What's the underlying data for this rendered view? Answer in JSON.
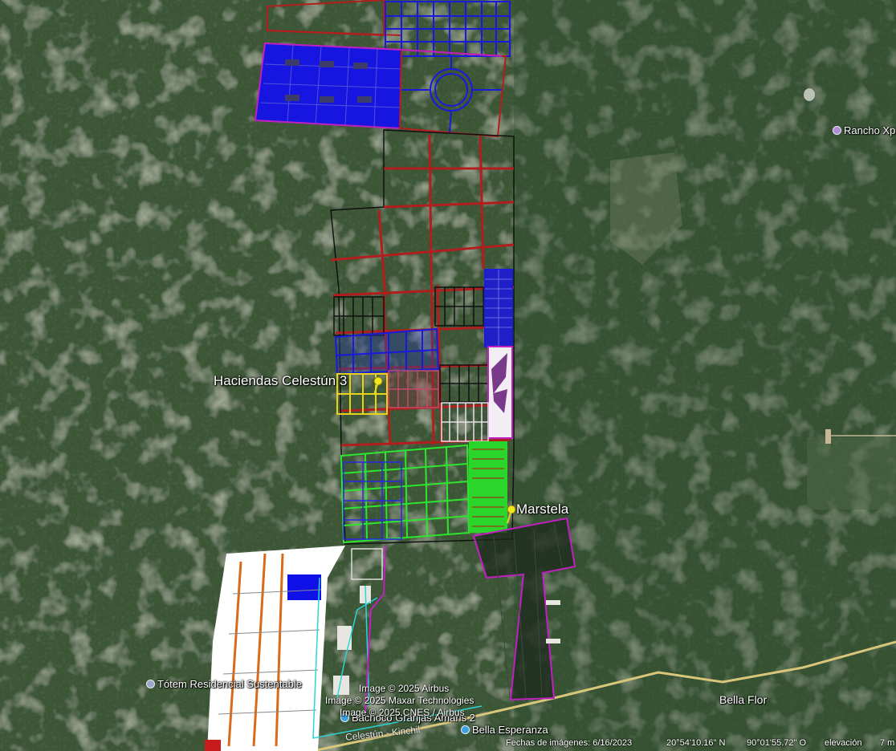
{
  "map": {
    "pins": [
      {
        "label": "Haciendas Celestún 3"
      },
      {
        "label": "Marstela"
      }
    ],
    "places": {
      "rancho": "Rancho Xp",
      "totem": "Tótem Residencial Sustentable",
      "bachoco": "Bachoco Granjas Amaris 2",
      "bella_esperanza": "Bella Esperanza",
      "bella_flor": "Bella Flor"
    },
    "road_label": "Celestún - Kinchil",
    "copyright": [
      "Image © 2025 Airbus",
      "Image © 2025 Maxar Technologies",
      "Image © 2025 CNES / Airbus"
    ],
    "status": {
      "imagery_date": "Fechas de imágenes: 6/16/2023",
      "lat": "20°54'10.16\" N",
      "lon": "90°01'55.72\" O",
      "elevation": "elevación",
      "eye": "7 m"
    },
    "colors": {
      "terrain": "#3a5536",
      "red_parcels": "#b21e1e",
      "blue_parcels": "#1a1adc",
      "green_parcels": "#2ee62e",
      "white_development": "#ffffff",
      "magenta_border": "#c21fc2",
      "road": "#d8c67a"
    }
  }
}
